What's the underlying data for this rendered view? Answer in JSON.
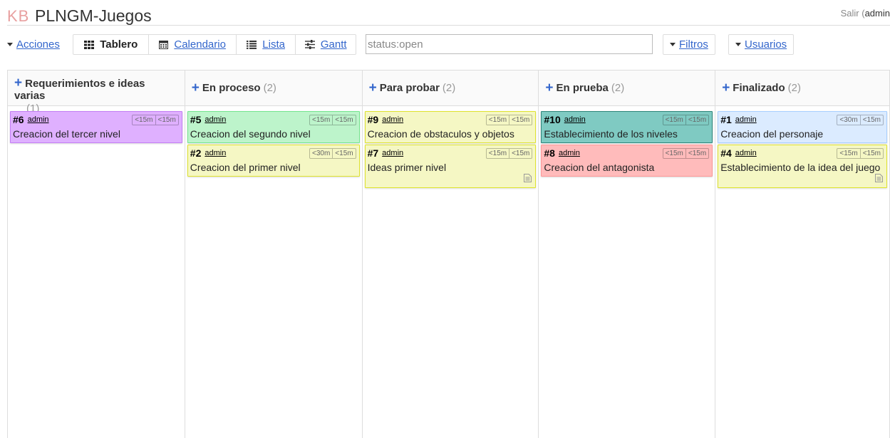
{
  "header": {
    "logo": "KB",
    "project_title": "PLNGM-Juegos",
    "logout_label": "Salir",
    "user_prefix": " (",
    "user_name": "admin"
  },
  "toolbar": {
    "actions_label": "Acciones",
    "views": [
      {
        "label": "Tablero",
        "icon": "th-icon",
        "active": true
      },
      {
        "label": "Calendario",
        "icon": "calendar-icon",
        "active": false
      },
      {
        "label": "Lista",
        "icon": "list-icon",
        "active": false
      },
      {
        "label": "Gantt",
        "icon": "sliders-icon",
        "active": false
      }
    ],
    "search_value": "status:open",
    "filters_label": "Filtros",
    "users_label": "Usuarios"
  },
  "colors": {
    "purple": {
      "bg": "#dfb0ff",
      "border": "#c37ef4"
    },
    "green": {
      "bg": "#bdf4cb",
      "border": "#74e58e"
    },
    "yellow": {
      "bg": "#f5f7c4",
      "border": "#dfe32d"
    },
    "teal": {
      "bg": "#7fcac2",
      "border": "#2d857a"
    },
    "red": {
      "bg": "#ffbbbb",
      "border": "#ff9797"
    },
    "blue": {
      "bg": "#dbebff",
      "border": "#a8cfff"
    }
  },
  "columns": [
    {
      "title": "Requerimientos e ideas varias",
      "count": "(1)",
      "tasks": [
        {
          "id": "#6",
          "owner": "admin",
          "title": "Creacion del tercer nivel",
          "time1": "<15m",
          "time2": "<15m",
          "color": "purple",
          "has_doc": false
        }
      ]
    },
    {
      "title": "En proceso",
      "count": "(2)",
      "tasks": [
        {
          "id": "#5",
          "owner": "admin",
          "title": "Creacion del segundo nivel",
          "time1": "<15m",
          "time2": "<15m",
          "color": "green",
          "has_doc": false
        },
        {
          "id": "#2",
          "owner": "admin",
          "title": "Creacion del primer nivel",
          "time1": "<30m",
          "time2": "<15m",
          "color": "yellow",
          "has_doc": false
        }
      ]
    },
    {
      "title": "Para probar",
      "count": "(2)",
      "tasks": [
        {
          "id": "#9",
          "owner": "admin",
          "title": "Creacion de obstaculos y objetos",
          "time1": "<15m",
          "time2": "<15m",
          "color": "yellow",
          "has_doc": false
        },
        {
          "id": "#7",
          "owner": "admin",
          "title": "Ideas primer nivel",
          "time1": "<15m",
          "time2": "<15m",
          "color": "yellow",
          "has_doc": true
        }
      ]
    },
    {
      "title": "En prueba",
      "count": "(2)",
      "tasks": [
        {
          "id": "#10",
          "owner": "admin",
          "title": "Establecimiento de los niveles",
          "time1": "<15m",
          "time2": "<15m",
          "color": "teal",
          "has_doc": false
        },
        {
          "id": "#8",
          "owner": "admin",
          "title": "Creacion del antagonista",
          "time1": "<15m",
          "time2": "<15m",
          "color": "red",
          "has_doc": false
        }
      ]
    },
    {
      "title": "Finalizado",
      "count": "(2)",
      "tasks": [
        {
          "id": "#1",
          "owner": "admin",
          "title": "Creacion del personaje",
          "time1": "<30m",
          "time2": "<15m",
          "color": "blue",
          "has_doc": false
        },
        {
          "id": "#4",
          "owner": "admin",
          "title": "Establecimiento de la idea del juego",
          "time1": "<15m",
          "time2": "<15m",
          "color": "yellow",
          "has_doc": true
        }
      ]
    }
  ]
}
